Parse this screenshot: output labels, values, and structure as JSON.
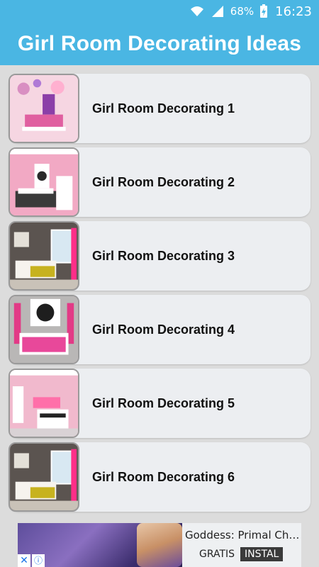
{
  "status_bar": {
    "battery_percent": "68%",
    "time": "16:23",
    "icons": [
      "wifi-icon",
      "signal-icon",
      "battery-charging-icon"
    ]
  },
  "app_bar": {
    "title": "Girl Room Decorating Ideas",
    "background_color": "#4ab6e3"
  },
  "items": [
    {
      "label": "Girl Room Decorating 1"
    },
    {
      "label": "Girl Room Decorating 2"
    },
    {
      "label": "Girl Room Decorating 3"
    },
    {
      "label": "Girl Room Decorating 4"
    },
    {
      "label": "Girl Room Decorating 5"
    },
    {
      "label": "Girl Room Decorating 6"
    }
  ],
  "ad": {
    "title": "Goddess: Primal Chao…",
    "price_label": "GRATIS",
    "install_label": "INSTAL",
    "close_icon": "close-icon",
    "info_icon": "info-icon"
  }
}
